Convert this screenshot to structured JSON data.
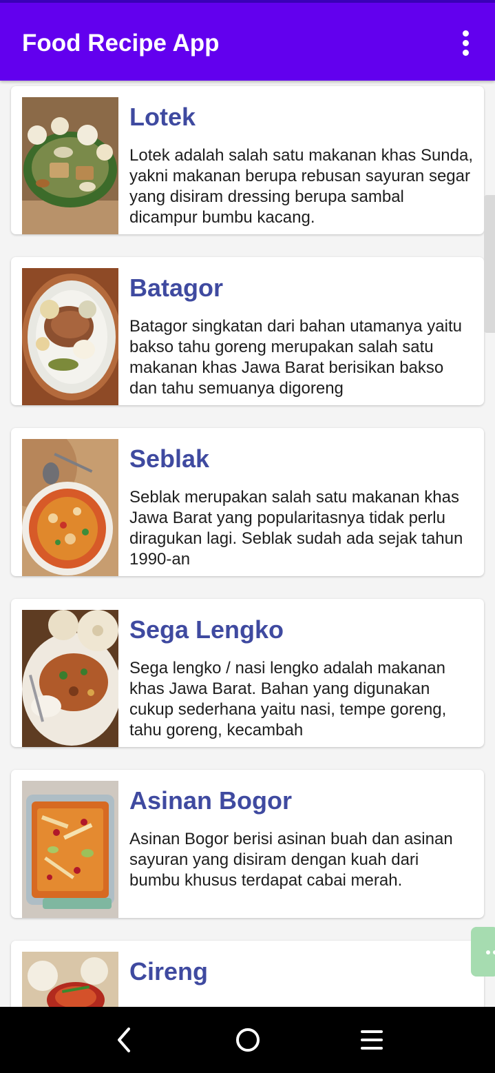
{
  "app_bar": {
    "title": "Food Recipe App",
    "background": "#6200ee",
    "overflow_icon": "more-vert-icon"
  },
  "recipes": [
    {
      "name": "Lotek",
      "description": "Lotek adalah salah satu makanan khas Sunda, yakni makanan berupa rebusan sayuran segar yang disiram dressing berupa sambal dicampur bumbu kacang."
    },
    {
      "name": "Batagor",
      "description": "Batagor singkatan dari bahan utamanya yaitu bakso tahu goreng merupakan salah satu makanan khas Jawa Barat berisikan bakso dan tahu semuanya digoreng"
    },
    {
      "name": "Seblak",
      "description": "Seblak merupakan salah satu makanan khas Jawa Barat yang popularitasnya tidak perlu diragukan lagi. Seblak sudah ada sejak tahun 1990-an"
    },
    {
      "name": "Sega Lengko",
      "description": "Sega lengko / nasi lengko adalah makanan khas Jawa Barat. Bahan yang digunakan cukup sederhana yaitu nasi, tempe goreng, tahu goreng, kecambah"
    },
    {
      "name": "Asinan Bogor",
      "description": "Asinan Bogor berisi asinan buah dan asinan sayuran yang disiram dengan kuah dari bumbu khusus terdapat cabai merah."
    },
    {
      "name": "Cireng",
      "description": ""
    }
  ],
  "system_nav": {
    "back_icon": "back-icon",
    "home_icon": "home-icon",
    "recents_icon": "recents-icon"
  },
  "colors": {
    "title_text": "#3f4aa0",
    "body_text": "#1e1e1e",
    "fab": "#a6dcb0"
  }
}
